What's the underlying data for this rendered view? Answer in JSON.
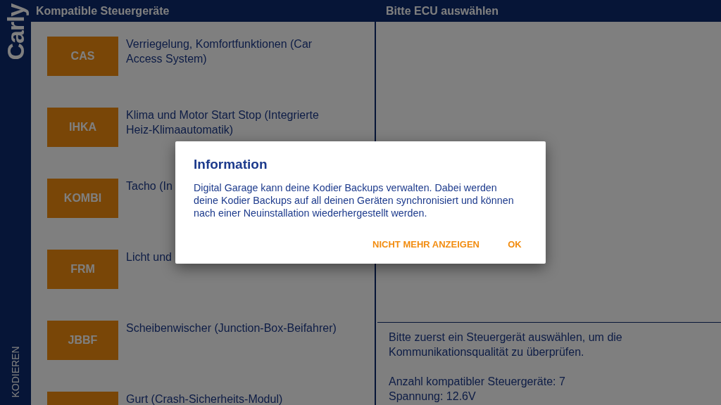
{
  "sidebar": {
    "logo": "Carly",
    "section": "KODIEREN"
  },
  "left_panel": {
    "title": "Kompatible Steuergeräte",
    "items": [
      {
        "code": "CAS",
        "description": "Verriegelung, Komfortfunktionen (Car Access System)"
      },
      {
        "code": "IHKA",
        "description": "Klima und Motor Start Stop (Integrierte Heiz-Klimaautomatik)"
      },
      {
        "code": "KOMBI",
        "description": "Tacho (In"
      },
      {
        "code": "FRM",
        "description": "Licht und"
      },
      {
        "code": "JBBF",
        "description": "Scheibenwischer (Junction-Box-Beifahrer)"
      },
      {
        "description": "Gurt (Crash-Sicherheits-Modul)"
      }
    ]
  },
  "right_panel": {
    "title": "Bitte ECU auswählen",
    "hint": "Bitte zuerst ein Steuergerät auswählen, um die Kommunikationsqualität zu überprüfen.",
    "count": "Anzahl kompatibler Steuergeräte: 7",
    "voltage": "Spannung: 12.6V"
  },
  "dialog": {
    "title": "Information",
    "message": "Digital Garage kann deine Kodier Backups verwalten. Dabei werden deine Kodier Backups auf all deinen Geräten synchronisiert und können nach einer Neuinstallation wiederhergestellt werden.",
    "buttons": [
      "NICHT MEHR ANZEIGEN",
      "OK"
    ]
  }
}
